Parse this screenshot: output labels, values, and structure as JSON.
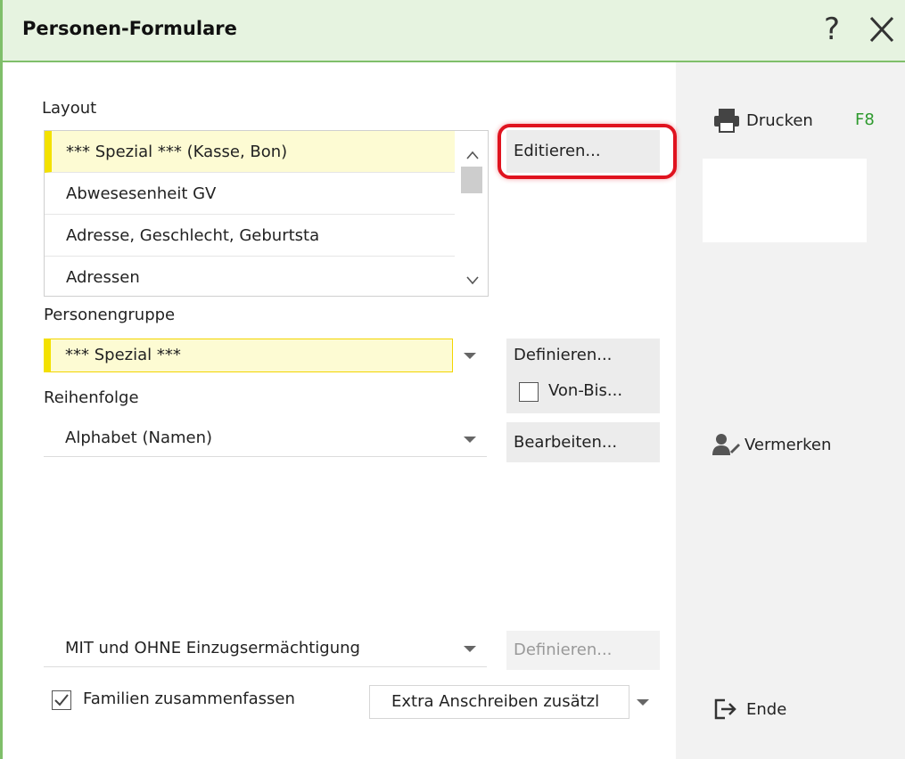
{
  "window": {
    "title": "Personen-Formulare"
  },
  "layout": {
    "label": "Layout",
    "items": [
      "*** Spezial *** (Kasse, Bon)",
      "Abwesesenheit GV",
      "Adresse, Geschlecht, Geburtsta",
      "Adressen"
    ],
    "edit_button": "Editieren..."
  },
  "personengruppe": {
    "label": "Personengruppe",
    "value": "*** Spezial ***",
    "define_button": "Definieren...",
    "vonbis_label": "Von-Bis..."
  },
  "reihenfolge": {
    "label": "Reihenfolge",
    "value": "Alphabet (Namen)",
    "edit_button": "Bearbeiten..."
  },
  "einzug": {
    "value": "MIT und OHNE Einzugsermächtigung",
    "define_button": "Definieren..."
  },
  "familien": {
    "label": "Familien zusammenfassen",
    "checked": true
  },
  "extra": {
    "value": "Extra Anschreiben zusätzl"
  },
  "sidebar": {
    "print_label": "Drucken",
    "print_shortcut": "F8",
    "note_label": "Vermerken",
    "end_label": "Ende"
  },
  "colors": {
    "accent_green": "#7fbf6a",
    "highlight_red": "#e0131f",
    "selection_yellow": "#f3e100",
    "shortcut_green": "#2e9a2e"
  }
}
